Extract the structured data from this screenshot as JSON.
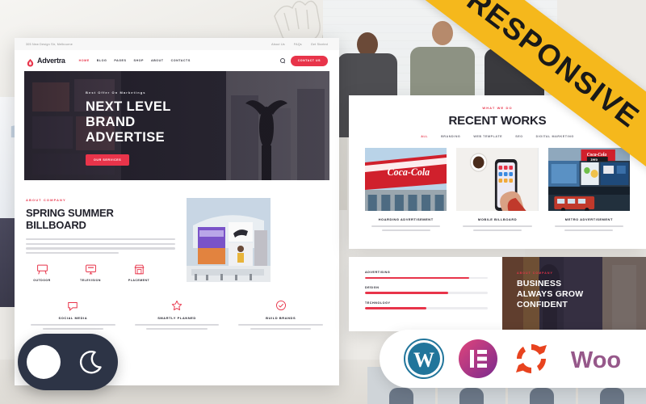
{
  "ribbon": {
    "label": "RESPONSIVE"
  },
  "mockup": {
    "topbar": {
      "address": "305 New Design Str, Melbourne",
      "links": [
        "About Us",
        "FAQs",
        "Get Started"
      ]
    },
    "nav": {
      "brand": "Advertra",
      "items": [
        {
          "label": "HOME",
          "active": true
        },
        {
          "label": "BLOG",
          "active": false
        },
        {
          "label": "PAGES",
          "active": false
        },
        {
          "label": "SHOP",
          "active": false
        },
        {
          "label": "ABOUT",
          "active": false
        },
        {
          "label": "CONTACTS",
          "active": false
        }
      ],
      "search_icon": "search-icon",
      "cta": "CONTACT US"
    },
    "hero": {
      "eyebrow": "Best Offer On Marketings",
      "title_line1": "NEXT LEVEL",
      "title_line2": "BRAND",
      "title_line3": "ADVERTISE",
      "button": "OUR SERVICES"
    },
    "about": {
      "eyebrow": "ABOUT COMPANY",
      "title_line1": "SPRING SUMMER",
      "title_line2": "BILLBOARD",
      "features": [
        {
          "label": "OUTDOOR",
          "icon": "billboard-icon"
        },
        {
          "label": "TELEVISION",
          "icon": "monitor-icon"
        },
        {
          "label": "PLACEMENT",
          "icon": "storefront-icon"
        }
      ]
    },
    "bottom_features": [
      {
        "title": "SOCIAL MEDIA",
        "icon": "chat-icon",
        "text": "Billboards capture repeat exposure ho marketing channel."
      },
      {
        "title": "SMARTLY PLANNED",
        "icon": "star-icon",
        "text": "Billboards capture repeat exposure ho marketing channel."
      },
      {
        "title": "BUILD BRANDS",
        "icon": "check-circle-icon",
        "text": "Billboards capture repeat exposure ho marketing channel."
      }
    ]
  },
  "works": {
    "eyebrow": "WHAT WE DO",
    "title": "RECENT WORKS",
    "filters": [
      {
        "label": "ALL",
        "active": true
      },
      {
        "label": "BRANDING",
        "active": false
      },
      {
        "label": "WEB TEMPLATE",
        "active": false
      },
      {
        "label": "SEO",
        "active": false
      },
      {
        "label": "DIGITAL MARKETING",
        "active": false
      }
    ],
    "cards": [
      {
        "caption": "HOARDING ADVERTISEMENT",
        "text": "Billboards capture into exposure business message more effectively."
      },
      {
        "caption": "MOBILE BILLBOARD",
        "text": "Billboards capture into exposure business message more effectively."
      },
      {
        "caption": "METRO ADVERTISEMENT",
        "text": "Billboards capture into exposure business message more effectively."
      }
    ]
  },
  "skills": {
    "bars": [
      {
        "name": "ADVERTISING",
        "value": 85
      },
      {
        "name": "DESIGN",
        "value": 68
      },
      {
        "name": "TECHNOLOGY",
        "value": 50
      }
    ],
    "business": {
      "eyebrow": "ABOUT COMPANY",
      "title_line1": "BUSINESS",
      "title_line2": "ALWAYS GROW",
      "title_line3": "CONFIDENT"
    }
  },
  "toggle": {
    "knob_icon": "circle-knob",
    "moon_icon": "moon-icon"
  },
  "badges": [
    {
      "name": "wordpress-badge",
      "label": "W"
    },
    {
      "name": "elementor-badge",
      "label": "E"
    },
    {
      "name": "sync-badge",
      "label": ""
    },
    {
      "name": "woocommerce-badge",
      "label": "Woo"
    }
  ],
  "colors": {
    "accent_red": "#e8344a",
    "ribbon_yellow": "#f5b81c",
    "dark_navy": "#2d3446",
    "wordpress_teal": "#21759b",
    "elementor_pink": "#c2256e",
    "woo_purple": "#96588a"
  }
}
